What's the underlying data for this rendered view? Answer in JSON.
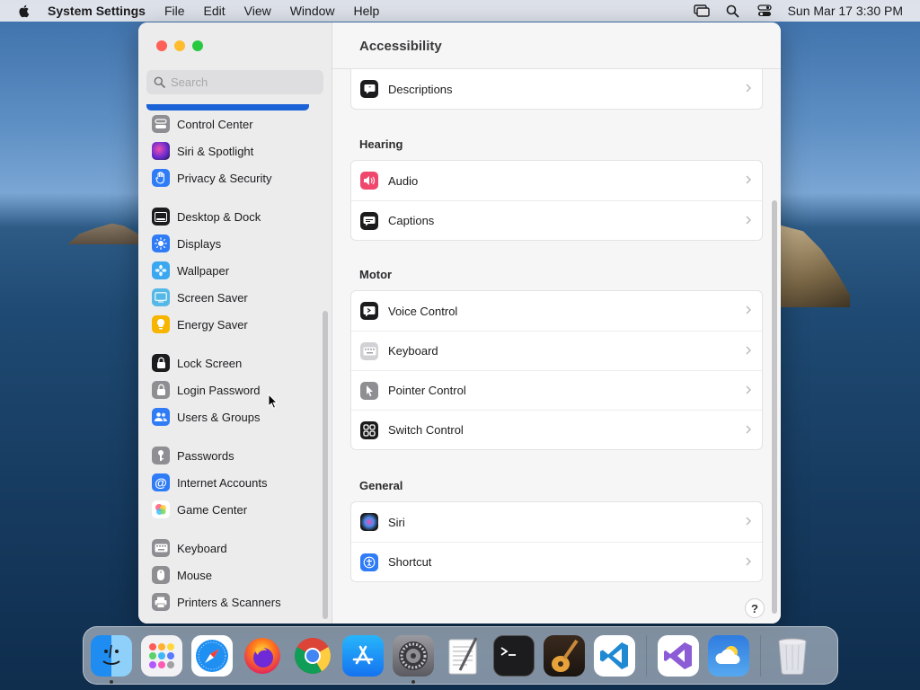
{
  "menubar": {
    "app_name": "System Settings",
    "items": [
      "File",
      "Edit",
      "View",
      "Window",
      "Help"
    ],
    "clock": "Sun Mar 17  3:30 PM"
  },
  "sidebar": {
    "search_placeholder": "Search",
    "items": [
      {
        "label": "Control Center",
        "icon": "control-center-icon",
        "color": "#8e8e93"
      },
      {
        "label": "Siri & Spotlight",
        "icon": "siri-icon",
        "color": "#5e2bbf"
      },
      {
        "label": "Privacy & Security",
        "icon": "hand-icon",
        "color": "#2f7cf6"
      },
      {
        "label": "Desktop & Dock",
        "icon": "dock-icon",
        "color": "#1c1c1e"
      },
      {
        "label": "Displays",
        "icon": "sun-icon",
        "color": "#2f7cf6"
      },
      {
        "label": "Wallpaper",
        "icon": "flower-icon",
        "color": "#3aa8f0"
      },
      {
        "label": "Screen Saver",
        "icon": "screen-saver-icon",
        "color": "#55b8e8"
      },
      {
        "label": "Energy Saver",
        "icon": "bulb-icon",
        "color": "#f7b500"
      },
      {
        "label": "Lock Screen",
        "icon": "lock-icon",
        "color": "#1c1c1e"
      },
      {
        "label": "Login Password",
        "icon": "lock-icon",
        "color": "#8e8e93"
      },
      {
        "label": "Users & Groups",
        "icon": "users-icon",
        "color": "#2f7cf6"
      },
      {
        "label": "Passwords",
        "icon": "key-icon",
        "color": "#8e8e93"
      },
      {
        "label": "Internet Accounts",
        "icon": "at-icon",
        "color": "#2f7cf6"
      },
      {
        "label": "Game Center",
        "icon": "game-center-icon",
        "color": "#ffffff"
      },
      {
        "label": "Keyboard",
        "icon": "keyboard-icon",
        "color": "#8e8e93"
      },
      {
        "label": "Mouse",
        "icon": "mouse-icon",
        "color": "#8e8e93"
      },
      {
        "label": "Printers & Scanners",
        "icon": "printer-icon",
        "color": "#8e8e93"
      }
    ]
  },
  "content": {
    "title": "Accessibility",
    "top_row": {
      "label": "Descriptions",
      "icon": "descriptions-icon",
      "color": "#1c1c1e"
    },
    "sections": [
      {
        "title": "Hearing",
        "rows": [
          {
            "label": "Audio",
            "icon": "speaker-icon",
            "color": "#f0476d"
          },
          {
            "label": "Captions",
            "icon": "captions-icon",
            "color": "#1c1c1e"
          }
        ]
      },
      {
        "title": "Motor",
        "rows": [
          {
            "label": "Voice Control",
            "icon": "voice-control-icon",
            "color": "#1c1c1e"
          },
          {
            "label": "Keyboard",
            "icon": "keyboard-icon",
            "color": "#c7c7cc"
          },
          {
            "label": "Pointer Control",
            "icon": "pointer-icon",
            "color": "#8e8e93"
          },
          {
            "label": "Switch Control",
            "icon": "switch-control-icon",
            "color": "#1c1c1e"
          }
        ]
      },
      {
        "title": "General",
        "rows": [
          {
            "label": "Siri",
            "icon": "siri-icon",
            "color": "#1c1c1e"
          },
          {
            "label": "Shortcut",
            "icon": "accessibility-shortcut-icon",
            "color": "#2f7cf6"
          }
        ]
      }
    ],
    "help_label": "?"
  },
  "dock": {
    "apps": [
      {
        "name": "Finder",
        "icon": "finder-icon",
        "running": true
      },
      {
        "name": "Launchpad",
        "icon": "launchpad-icon",
        "running": false
      },
      {
        "name": "Safari",
        "icon": "safari-icon",
        "running": false
      },
      {
        "name": "Firefox",
        "icon": "firefox-icon",
        "running": false
      },
      {
        "name": "Chrome",
        "icon": "chrome-icon",
        "running": false
      },
      {
        "name": "App Store",
        "icon": "app-store-icon",
        "running": false
      },
      {
        "name": "System Settings",
        "icon": "system-settings-icon",
        "running": true
      },
      {
        "name": "TextEdit",
        "icon": "textedit-icon",
        "running": false
      },
      {
        "name": "Terminal",
        "icon": "terminal-icon",
        "running": false
      },
      {
        "name": "GarageBand",
        "icon": "garageband-icon",
        "running": false
      },
      {
        "name": "VS Code",
        "icon": "vscode-icon",
        "running": false
      }
    ],
    "recent": [
      {
        "name": "Visual Studio",
        "icon": "visual-studio-icon"
      },
      {
        "name": "Weather",
        "icon": "weather-icon"
      }
    ],
    "trash": {
      "name": "Trash",
      "icon": "trash-icon"
    }
  }
}
